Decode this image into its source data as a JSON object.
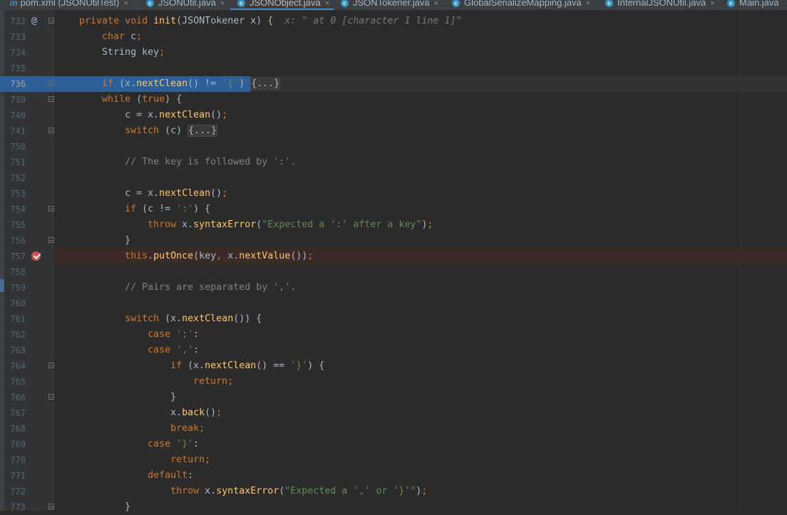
{
  "tabs": [
    {
      "label": "pom.xml (JSONUtilTest)",
      "icon": "maven-icon"
    },
    {
      "label": "JSONUtil.java",
      "icon": "class-icon"
    },
    {
      "label": "JSONObject.java",
      "icon": "class-icon",
      "active": true
    },
    {
      "label": "JSONTokener.java",
      "icon": "class-icon"
    },
    {
      "label": "GlobalSerializeMapping.java",
      "icon": "class-icon"
    },
    {
      "label": "InternalJSONUtil.java",
      "icon": "class-icon"
    },
    {
      "label": "Main.java",
      "icon": "class-icon"
    }
  ],
  "tab_close_glyph": "×",
  "colors": {
    "keyword": "#cc7832",
    "method": "#ffc66d",
    "string": "#6a8759",
    "comment": "#808080",
    "execution_highlight": "#2d6099",
    "breakpoint": "#c75450"
  },
  "editor": {
    "current_line": "736",
    "execution_point_line": "736",
    "breakpoint_line": "757",
    "lines": [
      {
        "n": "732",
        "text": "    private void init(JSONTokener x) {  x: \" at 0 [character 1 line 1]\""
      },
      {
        "n": "733",
        "text": "        char c;"
      },
      {
        "n": "734",
        "text": "        String key;"
      },
      {
        "n": "735",
        "text": ""
      },
      {
        "n": "736",
        "text": "        if (x.nextClean() != '{') {...}"
      },
      {
        "n": "739",
        "text": "        while (true) {"
      },
      {
        "n": "740",
        "text": "            c = x.nextClean();"
      },
      {
        "n": "741",
        "text": "            switch (c) {...}"
      },
      {
        "n": "750",
        "text": ""
      },
      {
        "n": "751",
        "text": "            // The key is followed by ':'."
      },
      {
        "n": "752",
        "text": ""
      },
      {
        "n": "753",
        "text": "            c = x.nextClean();"
      },
      {
        "n": "754",
        "text": "            if (c != ':') {"
      },
      {
        "n": "755",
        "text": "                throw x.syntaxError(\"Expected a ':' after a key\");"
      },
      {
        "n": "756",
        "text": "            }"
      },
      {
        "n": "757",
        "text": "            this.putOnce(key, x.nextValue());"
      },
      {
        "n": "758",
        "text": ""
      },
      {
        "n": "759",
        "text": "            // Pairs are separated by ','."
      },
      {
        "n": "760",
        "text": ""
      },
      {
        "n": "761",
        "text": "            switch (x.nextClean()) {"
      },
      {
        "n": "762",
        "text": "                case ';':"
      },
      {
        "n": "763",
        "text": "                case ',':"
      },
      {
        "n": "764",
        "text": "                    if (x.nextClean() == '}') {"
      },
      {
        "n": "765",
        "text": "                        return;"
      },
      {
        "n": "766",
        "text": "                    }"
      },
      {
        "n": "767",
        "text": "                    x.back();"
      },
      {
        "n": "768",
        "text": "                    break;"
      },
      {
        "n": "769",
        "text": "                case '}':"
      },
      {
        "n": "770",
        "text": "                    return;"
      },
      {
        "n": "771",
        "text": "                default:"
      },
      {
        "n": "772",
        "text": "                    throw x.syntaxError(\"Expected a ',' or '}'\");"
      },
      {
        "n": "773",
        "text": "            }"
      }
    ]
  }
}
